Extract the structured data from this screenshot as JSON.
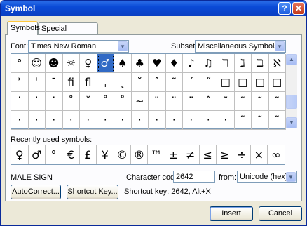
{
  "window": {
    "title": "Symbol",
    "help_label": "?",
    "close_label": "✕"
  },
  "tabs": [
    {
      "label": "Symbols"
    },
    {
      "label": "Special Characters"
    }
  ],
  "font": {
    "label": "Font:",
    "value": "Times New Roman"
  },
  "subset": {
    "label": "Subset:",
    "value": "Miscellaneous Symbols"
  },
  "grid": {
    "rows": [
      [
        "°",
        "☺",
        "☻",
        "☼",
        "♀",
        "♂",
        "♠",
        "♣",
        "♥",
        "♦",
        "♪",
        "♫",
        "ℸ",
        "ℷ",
        "ℶ",
        "ℵ"
      ],
      [
        "ʾ",
        "ʿ",
        "ˉ",
        "ﬁ",
        "ﬂ",
        "ˌ",
        "˛",
        "˘",
        "ˆ",
        "˜",
        "ˊ",
        "˝",
        "□",
        "□",
        "□",
        "□"
      ],
      [
        "˙",
        "˙",
        "˙",
        "˚",
        "˘",
        "˚",
        "˚",
        "~",
        "¨",
        "¨",
        "¨",
        "ˆ",
        "˜",
        "˜",
        "˜",
        "˜"
      ],
      [
        "·",
        "·",
        "·",
        "·",
        "·",
        "·",
        "·",
        "·",
        "·",
        "·",
        "·",
        "·",
        "·",
        "˜",
        "˜",
        "˜"
      ]
    ],
    "selected_row": 0,
    "selected_col": 5
  },
  "recent": {
    "label": "Recently used symbols:",
    "symbols": [
      "♀",
      "♂",
      "°",
      "€",
      "£",
      "¥",
      "©",
      "®",
      "™",
      "±",
      "≠",
      "≤",
      "≥",
      "÷",
      "×",
      "∞"
    ]
  },
  "char_name": "MALE SIGN",
  "char_code": {
    "label": "Character code:",
    "value": "2642"
  },
  "from": {
    "label": "from:",
    "value": "Unicode (hex)"
  },
  "buttons": {
    "autocorrect": "AutoCorrect...",
    "shortcut_key": "Shortcut Key...",
    "insert": "Insert",
    "cancel": "Cancel"
  },
  "shortcut_text": "Shortcut key: 2642, Alt+X",
  "icons": {
    "combo_arrow": "chevron-down-icon",
    "scroll_up": "chevron-up-icon",
    "scroll_down": "chevron-down-icon"
  }
}
